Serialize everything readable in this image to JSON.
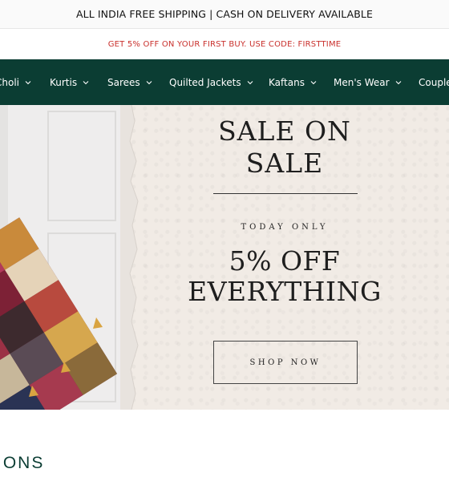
{
  "announcement": {
    "text": "ALL INDIA FREE SHIPPING | CASH ON DELIVERY AVAILABLE"
  },
  "promo": {
    "text": "GET 5% OFF ON YOUR FIRST BUY. USE CODE: FIRSTTIME",
    "color": "#c9302c"
  },
  "nav": {
    "background": "#0b3d33",
    "items": [
      {
        "label": "Choli"
      },
      {
        "label": "Kurtis"
      },
      {
        "label": "Sarees"
      },
      {
        "label": "Quilted Jackets"
      },
      {
        "label": "Kaftans"
      },
      {
        "label": "Men's Wear"
      },
      {
        "label": "Couple"
      }
    ]
  },
  "hero": {
    "line1": "SALE ON",
    "line2": "SALE",
    "tagline": "TODAY ONLY",
    "offer1": "5% OFF",
    "offer2": "EVERYTHING",
    "cta": "SHOP NOW"
  },
  "section": {
    "title": "IONS"
  }
}
